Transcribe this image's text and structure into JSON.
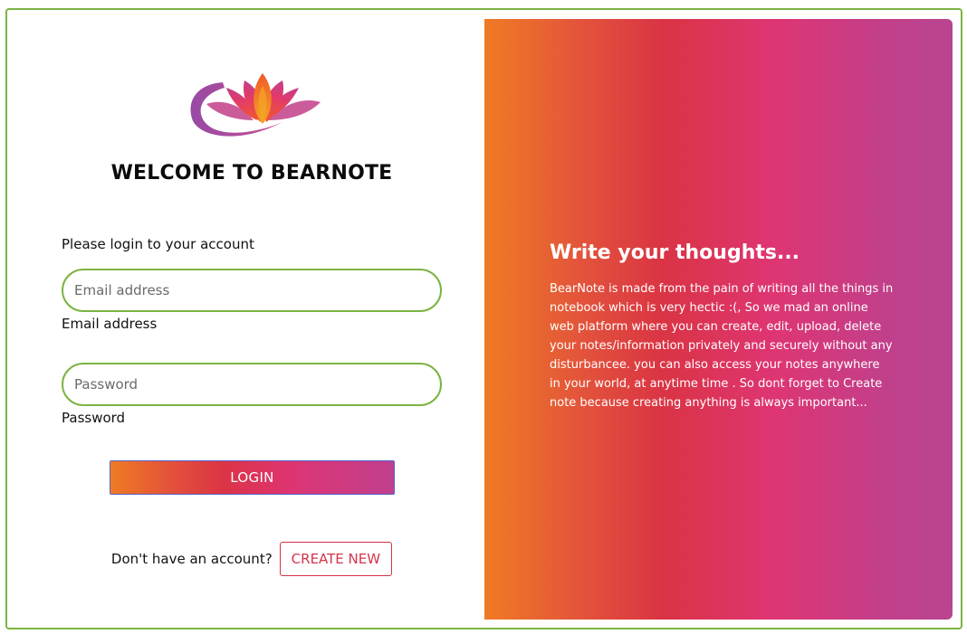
{
  "logo": {
    "icon": "lotus-logo",
    "colors": [
      "#ef7b24",
      "#de3470",
      "#8e3a9c"
    ]
  },
  "login": {
    "welcome_title": "WELCOME TO BEARNOTE",
    "subtitle": "Please login to your account",
    "email": {
      "placeholder": "Email address",
      "value": "",
      "label": "Email address"
    },
    "password": {
      "placeholder": "Password",
      "value": "",
      "label": "Password"
    },
    "login_button": "LOGIN",
    "no_account_text": "Don't have an account?",
    "create_button": "CREATE NEW"
  },
  "promo": {
    "title": "Write your thoughts...",
    "body": "BearNote is made from the pain of writing all the things in notebook which is very hectic :(, So we mad an online web platform where you can create, edit, upload, delete your notes/information privately and securely without any disturbancee. you can also access your notes anywhere in your world, at anytime time . So dont forget to Create note because creating anything is always important..."
  },
  "theme": {
    "border": "#7cb342",
    "gradient_start": "#ef7b24",
    "gradient_mid": "#da3444",
    "gradient_pink": "#de3573",
    "gradient_end": "#b9458f",
    "create_accent": "#d4344a"
  }
}
